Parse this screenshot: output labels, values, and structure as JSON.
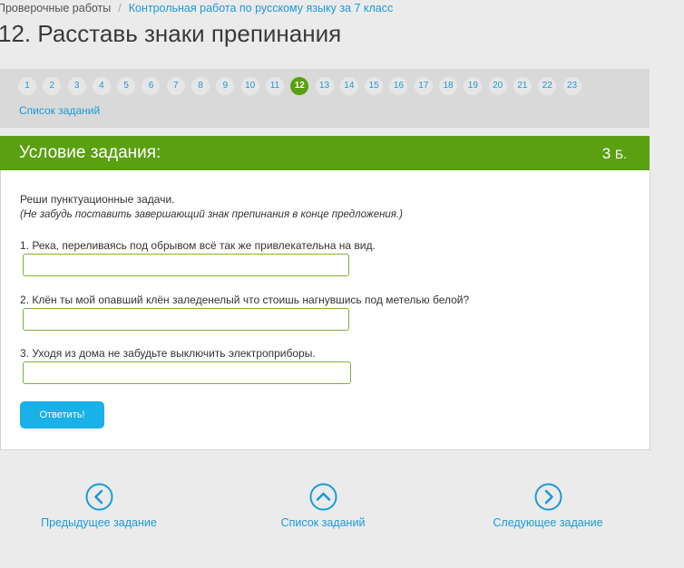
{
  "breadcrumb": {
    "root": "Проверочные работы",
    "separator": "/",
    "current": "Контрольная работа по русскому языку за 7 класс"
  },
  "page_title": "12. Расставь знаки препинания",
  "task_nav": {
    "pages": [
      "1",
      "2",
      "3",
      "4",
      "5",
      "6",
      "7",
      "8",
      "9",
      "10",
      "11",
      "12",
      "13",
      "14",
      "15",
      "16",
      "17",
      "18",
      "19",
      "20",
      "21",
      "22",
      "23"
    ],
    "active_page": "12",
    "task_list_label": "Список заданий"
  },
  "panel": {
    "title": "Условие задания:",
    "points_value": "3",
    "points_unit": "Б."
  },
  "task": {
    "instruction": "Реши пунктуационные задачи.",
    "hint": "(Не забудь поставить завершающий знак препинания в конце предложения.)",
    "questions": [
      {
        "text": "1. Река, переливаясь под обрывом всё так же привлекательна на вид.",
        "value": ""
      },
      {
        "text": "2. Клён ты мой опавший клён заледенелый что стоишь нагнувшись под метелью белой?",
        "value": ""
      },
      {
        "text": "3. Уходя из дома не забудьте выключить электроприборы.",
        "value": ""
      }
    ],
    "submit_label": "Ответить!"
  },
  "bottom_nav": {
    "prev_label": "Предыдущее задание",
    "list_label": "Список заданий",
    "next_label": "Следующее задание"
  },
  "colors": {
    "accent_green": "#5aa010",
    "link_blue": "#1a9bd7",
    "button_blue": "#1ab0e8",
    "input_border": "#7fb23a"
  }
}
